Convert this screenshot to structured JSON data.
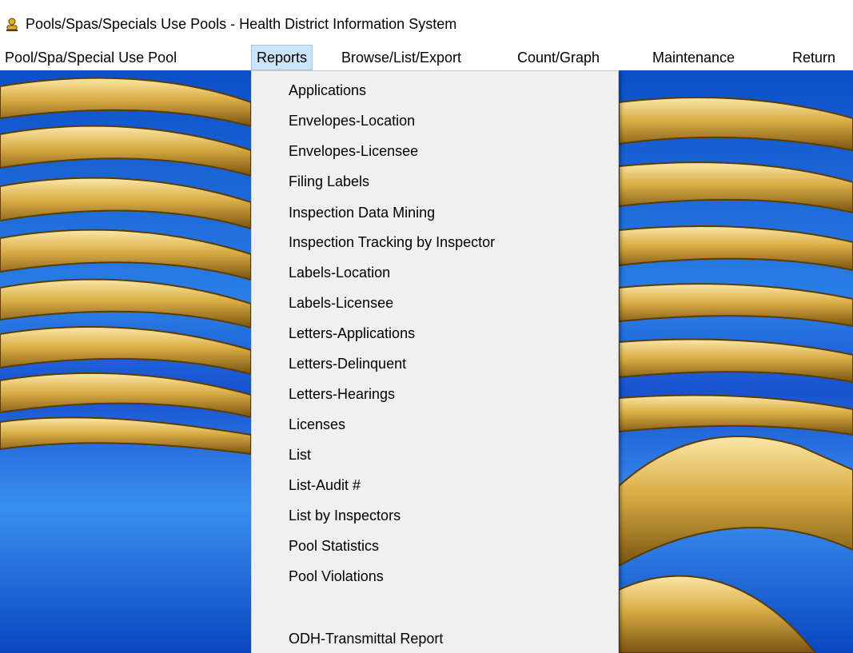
{
  "window": {
    "title": "Pools/Spas/Specials Use Pools - Health District Information System",
    "icon": "app-person-icon"
  },
  "menubar": {
    "items": [
      {
        "label": "Pool/Spa/Special Use Pool"
      },
      {
        "label": "Reports",
        "active": true
      },
      {
        "label": "Browse/List/Export"
      },
      {
        "label": "Count/Graph"
      },
      {
        "label": "Maintenance"
      },
      {
        "label": "Return"
      }
    ]
  },
  "reports_menu": {
    "items": [
      {
        "label": "Applications"
      },
      {
        "label": "Envelopes-Location"
      },
      {
        "label": "Envelopes-Licensee"
      },
      {
        "label": "Filing Labels"
      },
      {
        "label": "Inspection Data Mining"
      },
      {
        "label": "Inspection Tracking by Inspector"
      },
      {
        "label": "Labels-Location"
      },
      {
        "label": "Labels-Licensee"
      },
      {
        "label": "Letters-Applications"
      },
      {
        "label": "Letters-Delinquent"
      },
      {
        "label": "Letters-Hearings"
      },
      {
        "label": "Licenses"
      },
      {
        "label": "List"
      },
      {
        "label": "List-Audit #"
      },
      {
        "label": "List by Inspectors"
      },
      {
        "label": "Pool Statistics"
      },
      {
        "label": "Pool Violations"
      },
      {
        "label": "ODH-Transmittal Report"
      }
    ]
  },
  "colors": {
    "menu_highlight": "#cce4f7",
    "menu_highlight_border": "#99c9ef",
    "dropdown_bg": "#f0f0f0",
    "backdrop_blue": "#1a63d6",
    "backdrop_gold": "#d9b04a"
  }
}
